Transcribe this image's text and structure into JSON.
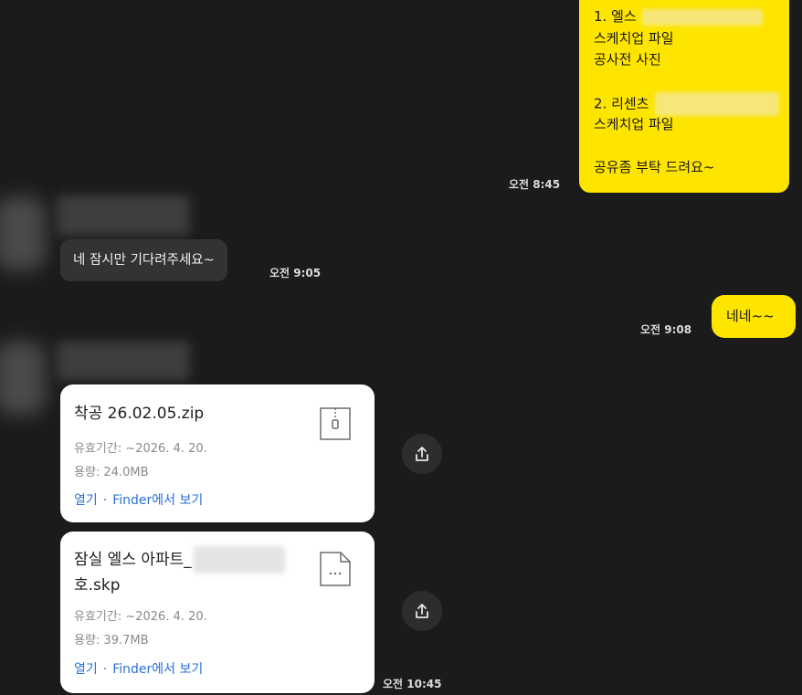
{
  "messages": {
    "out1": {
      "lines": [
        "1. 엘스",
        "스케치업 파일",
        "공사전 사진",
        "",
        "2. 리센츠",
        "스케치업 파일",
        "",
        "공유좀 부탁 드려요~"
      ],
      "time": "오전 8:45"
    },
    "in1": {
      "text": "네 잠시만 기다려주세요~",
      "time": "오전 9:05"
    },
    "out2": {
      "text": "네네~~",
      "time": "오전 9:08"
    },
    "files": [
      {
        "name_line1": "착공 26.02.05.zip",
        "name_line2": "",
        "expiry": "유효기간: ~2026. 4. 20.",
        "size": "용량: 24.0MB",
        "open_label": "열기",
        "dot": "·",
        "finder_label": "Finder에서 보기",
        "icon": "zip-file-icon"
      },
      {
        "name_line1": "잠실 엘스 아파트_",
        "name_line2": "호.skp",
        "expiry": "유효기간: ~2026. 4. 20.",
        "size": "용량: 39.7MB",
        "open_label": "열기",
        "dot": "·",
        "finder_label": "Finder에서 보기",
        "icon": "document-file-icon"
      }
    ],
    "files_time": "오전 10:45"
  },
  "colors": {
    "background": "#1b1b1c",
    "outgoing_bubble": "#fee500",
    "incoming_bubble": "#333334",
    "link": "#2a6fd6"
  },
  "icons": [
    "share-icon",
    "zip-file-icon",
    "document-file-icon"
  ]
}
